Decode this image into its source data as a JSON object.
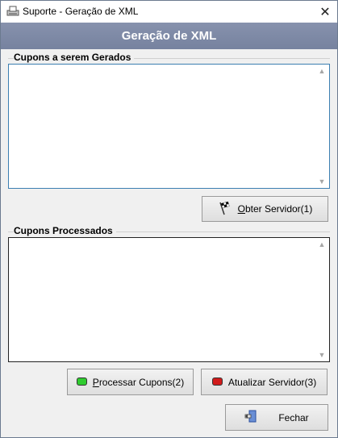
{
  "window": {
    "title": "Suporte - Geração de XML",
    "close_glyph": "✕",
    "app_icon": "printer-icon"
  },
  "header": {
    "title": "Geração de XML"
  },
  "groups": {
    "to_generate": {
      "label": "Cupons a serem Gerados",
      "value": ""
    },
    "processed": {
      "label": "Cupons Processados",
      "value": ""
    }
  },
  "buttons": {
    "obter": {
      "accel": "O",
      "rest": "bter Servidor(1)",
      "icon": "checkered-flag-icon"
    },
    "processar": {
      "accel": "P",
      "rest": "rocessar Cupons(2)",
      "icon": "green-led-icon",
      "color": "#2fcc2f"
    },
    "atualizar": {
      "label": "Atualizar Servidor(3)",
      "icon": "red-led-icon",
      "color": "#d11b1b"
    },
    "fechar": {
      "label": "Fechar",
      "icon": "exit-door-icon"
    }
  },
  "scroll": {
    "up": "▲",
    "down": "▼"
  }
}
